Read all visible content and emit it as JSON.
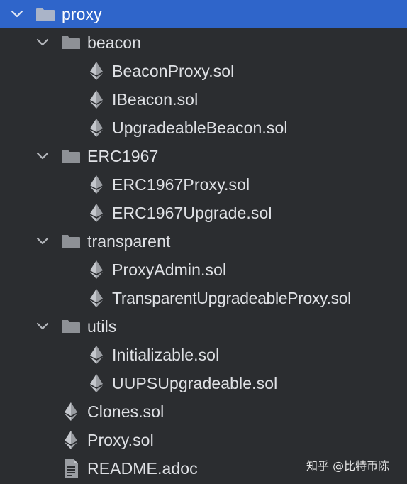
{
  "tree": {
    "root": {
      "label": "proxy",
      "expanded": true,
      "selected": true
    },
    "items": [
      {
        "label": "beacon",
        "type": "folder",
        "expanded": true
      },
      {
        "label": "BeaconProxy.sol",
        "type": "sol"
      },
      {
        "label": "IBeacon.sol",
        "type": "sol"
      },
      {
        "label": "UpgradeableBeacon.sol",
        "type": "sol"
      },
      {
        "label": "ERC1967",
        "type": "folder",
        "expanded": true
      },
      {
        "label": "ERC1967Proxy.sol",
        "type": "sol"
      },
      {
        "label": "ERC1967Upgrade.sol",
        "type": "sol"
      },
      {
        "label": "transparent",
        "type": "folder",
        "expanded": true
      },
      {
        "label": "ProxyAdmin.sol",
        "type": "sol"
      },
      {
        "label": "TransparentUpgradeableProxy.sol",
        "type": "sol"
      },
      {
        "label": "utils",
        "type": "folder",
        "expanded": true
      },
      {
        "label": "Initializable.sol",
        "type": "sol"
      },
      {
        "label": "UUPSUpgradeable.sol",
        "type": "sol"
      },
      {
        "label": "Clones.sol",
        "type": "sol"
      },
      {
        "label": "Proxy.sol",
        "type": "sol"
      },
      {
        "label": "README.adoc",
        "type": "doc"
      }
    ]
  },
  "watermark": "知乎 @比特币陈",
  "icons": {
    "chevron": "chevron-down-icon",
    "folder": "folder-icon",
    "sol": "ethereum-icon",
    "doc": "document-icon"
  },
  "colors": {
    "background": "#2b2d30",
    "selection": "#2f65ca",
    "text": "#dfe1e5",
    "icon": "#8e9196"
  }
}
